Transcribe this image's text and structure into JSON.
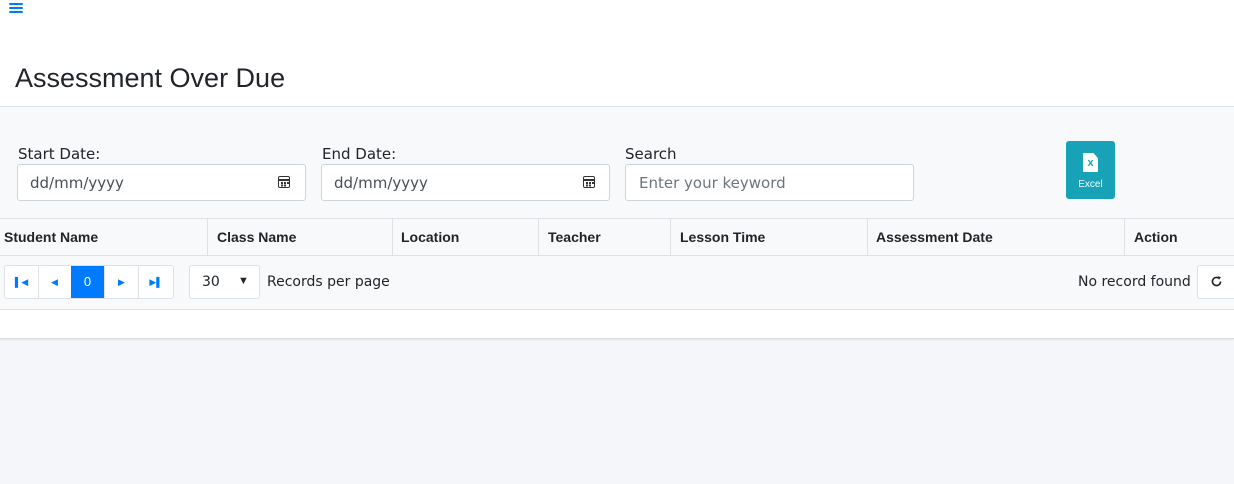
{
  "header": {
    "menu_icon": "hamburger-icon",
    "accent": "#007bff"
  },
  "page": {
    "title": "Assessment Over Due"
  },
  "filters": {
    "start_date": {
      "label": "Start Date:",
      "value": "dd/mm/yyyy",
      "icon": "calendar-icon"
    },
    "end_date": {
      "label": "End Date:",
      "value": "dd/mm/yyyy",
      "icon": "calendar-icon"
    },
    "search": {
      "label": "Search",
      "placeholder": "Enter your keyword",
      "value": ""
    },
    "excel_button": {
      "label": "Excel",
      "icon": "excel-file-icon",
      "color": "#17a2b8"
    }
  },
  "table": {
    "columns": [
      "Student Name",
      "Class Name",
      "Location",
      "Teacher",
      "Lesson Time",
      "Assessment Date",
      "Action"
    ],
    "rows": []
  },
  "pagination": {
    "first_icon": "first-page-icon",
    "prev_icon": "prev-page-icon",
    "current_page": "0",
    "next_icon": "next-page-icon",
    "last_icon": "last-page-icon",
    "records_per_page": "30",
    "records_per_page_label": "Records per page",
    "status": "No record found",
    "refresh_icon": "refresh-icon"
  }
}
